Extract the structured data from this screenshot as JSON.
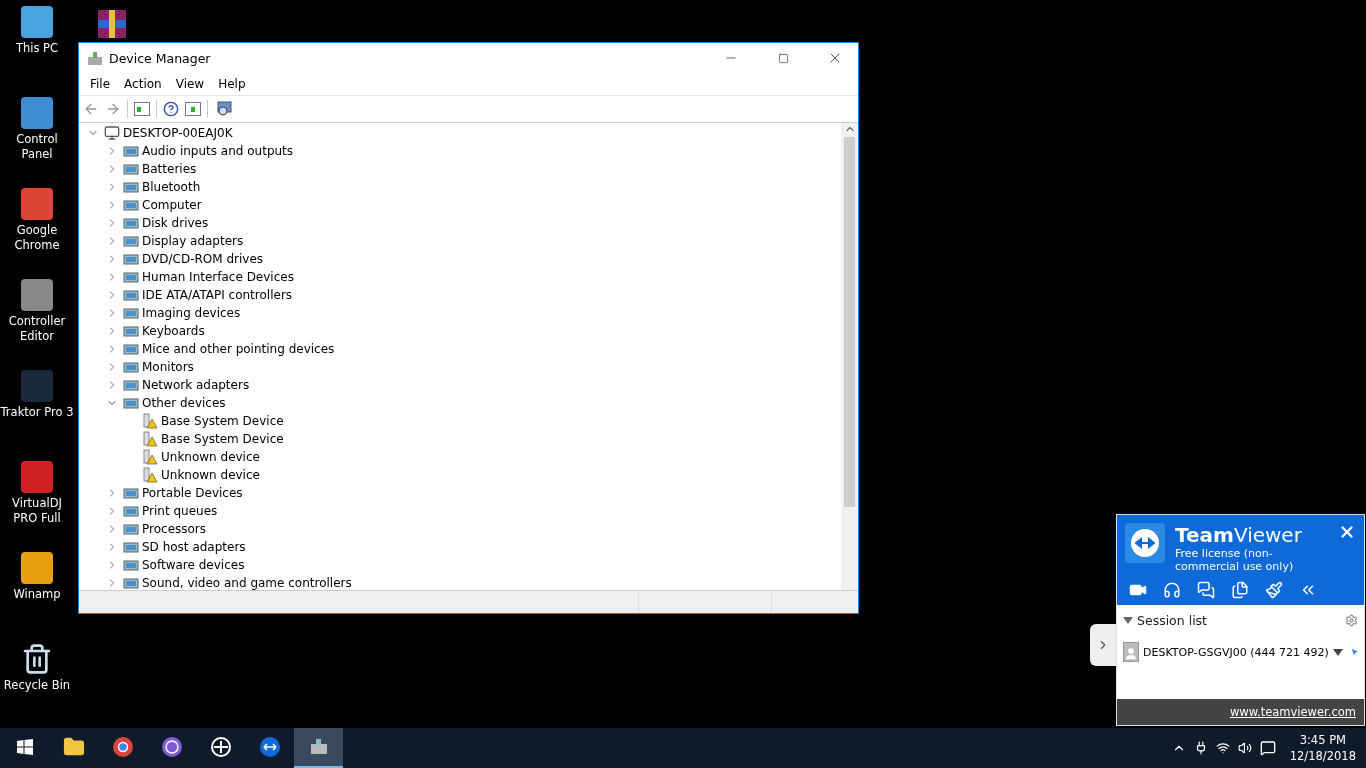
{
  "desktop_icons": [
    {
      "label": "This PC"
    },
    {
      "label": "Control Panel"
    },
    {
      "label": "Google Chrome"
    },
    {
      "label": "Controller Editor"
    },
    {
      "label": "Traktor Pro 3"
    },
    {
      "label": "VirtualDJ PRO Full"
    },
    {
      "label": "Winamp"
    },
    {
      "label": "Recycle Bin"
    }
  ],
  "window": {
    "title": "Device Manager",
    "menu": [
      "File",
      "Action",
      "View",
      "Help"
    ],
    "tree": {
      "label": "DESKTOP-00EAJ0K",
      "expanded": true,
      "children": [
        {
          "label": "Audio inputs and outputs",
          "expanded": false
        },
        {
          "label": "Batteries",
          "expanded": false
        },
        {
          "label": "Bluetooth",
          "expanded": false
        },
        {
          "label": "Computer",
          "expanded": false
        },
        {
          "label": "Disk drives",
          "expanded": false
        },
        {
          "label": "Display adapters",
          "expanded": false
        },
        {
          "label": "DVD/CD-ROM drives",
          "expanded": false
        },
        {
          "label": "Human Interface Devices",
          "expanded": false
        },
        {
          "label": "IDE ATA/ATAPI controllers",
          "expanded": false
        },
        {
          "label": "Imaging devices",
          "expanded": false
        },
        {
          "label": "Keyboards",
          "expanded": false
        },
        {
          "label": "Mice and other pointing devices",
          "expanded": false
        },
        {
          "label": "Monitors",
          "expanded": false
        },
        {
          "label": "Network adapters",
          "expanded": false
        },
        {
          "label": "Other devices",
          "expanded": true,
          "children": [
            {
              "label": "Base System Device",
              "warning": true
            },
            {
              "label": "Base System Device",
              "warning": true
            },
            {
              "label": "Unknown device",
              "warning": true
            },
            {
              "label": "Unknown device",
              "warning": true
            }
          ]
        },
        {
          "label": "Portable Devices",
          "expanded": false
        },
        {
          "label": "Print queues",
          "expanded": false
        },
        {
          "label": "Processors",
          "expanded": false
        },
        {
          "label": "SD host adapters",
          "expanded": false
        },
        {
          "label": "Software devices",
          "expanded": false
        },
        {
          "label": "Sound, video and game controllers",
          "expanded": false
        }
      ]
    }
  },
  "teamviewer": {
    "title": "**Team**Viewer",
    "subtitle": "Free license (non-commercial use only)",
    "session_list": {
      "title": "Session list",
      "expanded": true,
      "sessions": [
        {
          "name": "DESKTOP-GSGVJ00 (444 721 492)"
        }
      ]
    },
    "link": "www.teamviewer.com"
  },
  "taskbar": {
    "apps": [
      {
        "selected": false
      },
      {
        "selected": false
      },
      {
        "selected": false
      },
      {
        "selected": false
      },
      {
        "selected": false
      },
      {
        "selected": true
      }
    ],
    "time": "3:45 PM",
    "date": "12/18/2018"
  }
}
